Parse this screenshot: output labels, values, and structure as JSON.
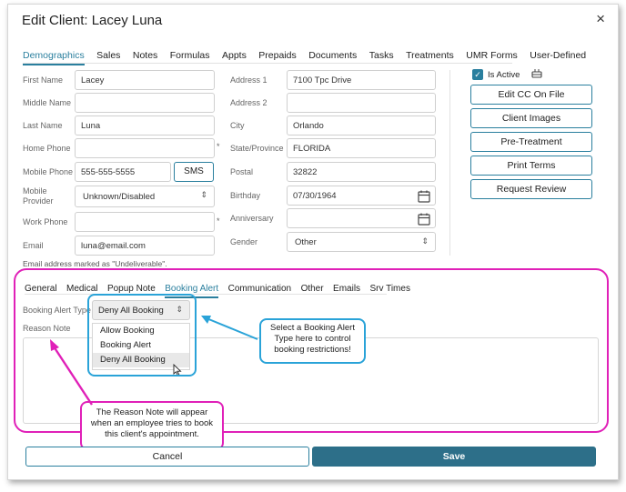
{
  "dialog": {
    "title": "Edit Client: Lacey Luna",
    "close_glyph": "×"
  },
  "tabs": [
    "Demographics",
    "Sales",
    "Notes",
    "Formulas",
    "Appts",
    "Prepaids",
    "Documents",
    "Tasks",
    "Treatments",
    "UMR Forms",
    "User-Defined"
  ],
  "form": {
    "first_name": {
      "label": "First Name",
      "value": "Lacey"
    },
    "middle_name": {
      "label": "Middle Name",
      "value": ""
    },
    "last_name": {
      "label": "Last Name",
      "value": "Luna"
    },
    "home_phone": {
      "label": "Home Phone",
      "value": ""
    },
    "mobile_phone": {
      "label": "Mobile Phone",
      "value": "555-555-5555"
    },
    "sms_label": "SMS",
    "mobile_provider": {
      "label_line1": "Mobile",
      "label_line2": "Provider",
      "value": "Unknown/Disabled"
    },
    "work_phone": {
      "label": "Work Phone",
      "value": ""
    },
    "email": {
      "label": "Email",
      "value": "luna@email.com"
    },
    "address1": {
      "label": "Address 1",
      "value": "7100 Tpc Drive"
    },
    "address2": {
      "label": "Address 2",
      "value": ""
    },
    "city": {
      "label": "City",
      "value": "Orlando"
    },
    "state": {
      "label": "State/Province",
      "value": "FLORIDA"
    },
    "postal": {
      "label": "Postal",
      "value": "32822"
    },
    "birthday": {
      "label": "Birthday",
      "value": "07/30/1964"
    },
    "anniversary": {
      "label": "Anniversary",
      "value": ""
    },
    "gender": {
      "label": "Gender",
      "value": "Other"
    },
    "required_marker": "*",
    "undeliverable_note": "Email address marked as \"Undeliverable\"."
  },
  "right_panel": {
    "is_active_label": "Is Active",
    "is_active_checked": true,
    "buttons": [
      "Edit CC On File",
      "Client Images",
      "Pre-Treatment",
      "Print Terms",
      "Request Review"
    ]
  },
  "sub_tabs": [
    "General",
    "Medical",
    "Popup Note",
    "Booking Alert",
    "Communication",
    "Other",
    "Emails",
    "Srv Times"
  ],
  "booking_alert": {
    "type_label": "Booking Alert Type",
    "selected": "Deny All Booking",
    "options": [
      "Allow Booking",
      "Booking Alert",
      "Deny All Booking"
    ],
    "reason_label": "Reason Note"
  },
  "callouts": {
    "blue": "Select a Booking Alert Type here to control booking restrictions!",
    "magenta": "The Reason Note will appear when an employee tries to book this client's appointment."
  },
  "footer": {
    "cancel": "Cancel",
    "save": "Save"
  },
  "colors": {
    "accent": "#2a7f9e",
    "save_bg": "#2d6f89",
    "callout_magenta": "#e020b8",
    "callout_blue": "#2aa3d8"
  }
}
